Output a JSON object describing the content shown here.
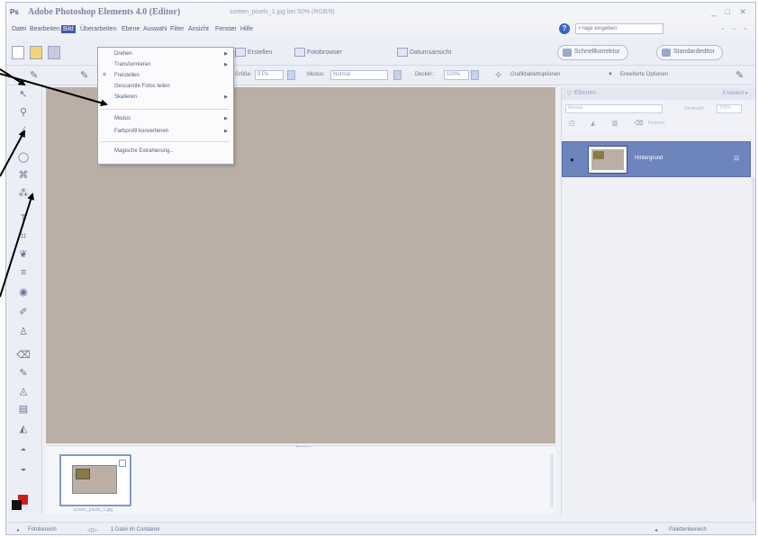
{
  "window": {
    "app_icon": "Ps",
    "title": "Adobe Photoshop Elements 4.0 (Editor)",
    "document": "screen_pixels_1.jpg bei 50% (RGB/8)",
    "controls": "_ □ ✕"
  },
  "menubar": {
    "items": [
      "Datei",
      "Bearbeiten",
      "Bild",
      "Überarbeiten",
      "Ebene",
      "Auswahl",
      "Filter",
      "Ansicht",
      "Fenster",
      "Hilfe"
    ],
    "active": "Bild",
    "help_placeholder": "Frage eingeben",
    "mini_controls": "▫ ▫ ▫"
  },
  "shortcuts": {
    "erstellen": "Erstellen",
    "fotobrowser": "Fotobrowser",
    "datumsansicht": "Datumsansicht",
    "schnellkorrektur": "Schnellkorrektur",
    "standardeditor": "Standardeditor"
  },
  "options": {
    "groesse_label": "Größe:",
    "groesse_value": "9 Px",
    "modus_label": "Modus:",
    "modus_value": "Normal",
    "deckkraft_label": "Deckkr.:",
    "deckkraft_value": "100%",
    "tablet_label": "Grafiktablettoptionen",
    "erweitert_label": "Erweiterte Optionen"
  },
  "bild_menu": {
    "items": [
      {
        "label": "Drehen",
        "submenu": true
      },
      {
        "label": "Transformieren",
        "submenu": true
      },
      {
        "label": "Freistellen",
        "submenu": false
      },
      {
        "label": "Gescannte Fotos teilen",
        "submenu": false
      },
      {
        "label": "Skalieren",
        "submenu": true
      },
      {
        "label": "Modus",
        "submenu": true
      },
      {
        "label": "Farbprofil konvertieren",
        "submenu": true
      },
      {
        "label": "Magische Extrahierung...",
        "submenu": false
      }
    ]
  },
  "palette": {
    "title": "Ebenen",
    "more": "Erweitert ▸",
    "blend_mode": "Normal",
    "opacity_label": "Deckkraft:",
    "opacity_value": "100%",
    "fix_label": "Fixieren:",
    "layer_name": "Hintergrund"
  },
  "projectbin": {
    "thumb_name": "screen_pixels_1.jpg"
  },
  "status": {
    "left": "Fotobereich",
    "count": "1 Datei im Container",
    "right": "Palettenbereich"
  }
}
